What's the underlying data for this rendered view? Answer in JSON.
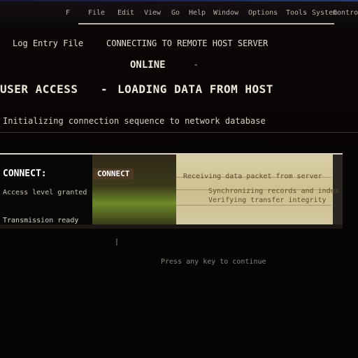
{
  "menu": {
    "items": [
      "F",
      "File",
      "Edit",
      "View",
      "Go",
      "Help",
      "Window",
      "Options",
      "Tools",
      "System",
      "Control"
    ]
  },
  "header": {
    "left_label": "Log Entry File",
    "right_label": "CONNECTING TO REMOTE HOST SERVER"
  },
  "title": {
    "text": "ONLINE",
    "dash": "-"
  },
  "main": {
    "headline_left": "USER ACCESS",
    "headline_sep": "-",
    "headline_right": "LOADING DATA FROM HOST"
  },
  "subline": {
    "text": "Initializing connection sequence to network database"
  },
  "panel": {
    "left_key": "CONNECT:",
    "button_label": "CONNECT",
    "left_sub1": "Access level granted",
    "left_sub2": "Transmission ready",
    "right_text1": "Receiving data packet from server",
    "right_text2": "Synchronizing records and index",
    "right_text3": "Verifying transfer integrity"
  },
  "footer": {
    "text": "Press any key to continue"
  }
}
